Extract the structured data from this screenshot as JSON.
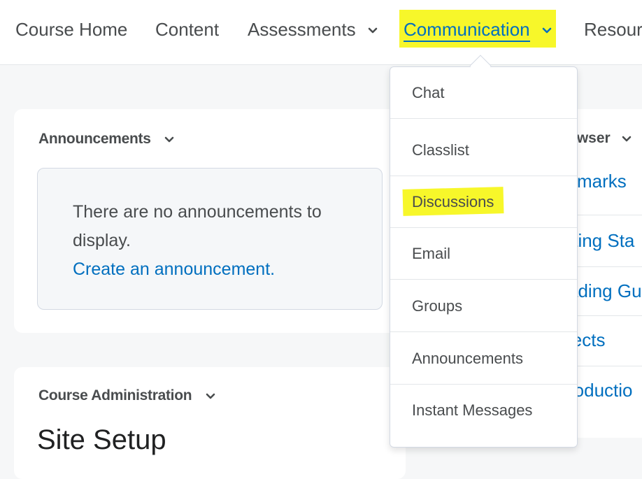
{
  "nav": {
    "items": [
      {
        "label": "Course Home",
        "has_menu": false
      },
      {
        "label": "Content",
        "has_menu": false
      },
      {
        "label": "Assessments",
        "has_menu": true
      },
      {
        "label": "Communication",
        "has_menu": true,
        "active": true
      },
      {
        "label": "Resour",
        "has_menu": false
      }
    ],
    "highlight_color": "#f7f72a",
    "active_color": "#006fbf"
  },
  "announcements": {
    "title": "Announcements",
    "empty_message": "There are no announcements to display.",
    "create_link": "Create an announcement."
  },
  "course_admin": {
    "title": "Course Administration",
    "heading": "Site Setup"
  },
  "right_widget": {
    "title_fragment": "owser",
    "links": [
      "kmarks",
      "tting Sta",
      "ading Gu",
      "jects",
      "roductio"
    ]
  },
  "dropdown": {
    "items": [
      {
        "label": "Chat"
      },
      {
        "label": "Classlist"
      },
      {
        "label": "Discussions",
        "highlighted": true
      },
      {
        "label": "Email"
      },
      {
        "label": "Groups"
      },
      {
        "label": "Announcements"
      },
      {
        "label": "Instant Messages"
      }
    ]
  }
}
